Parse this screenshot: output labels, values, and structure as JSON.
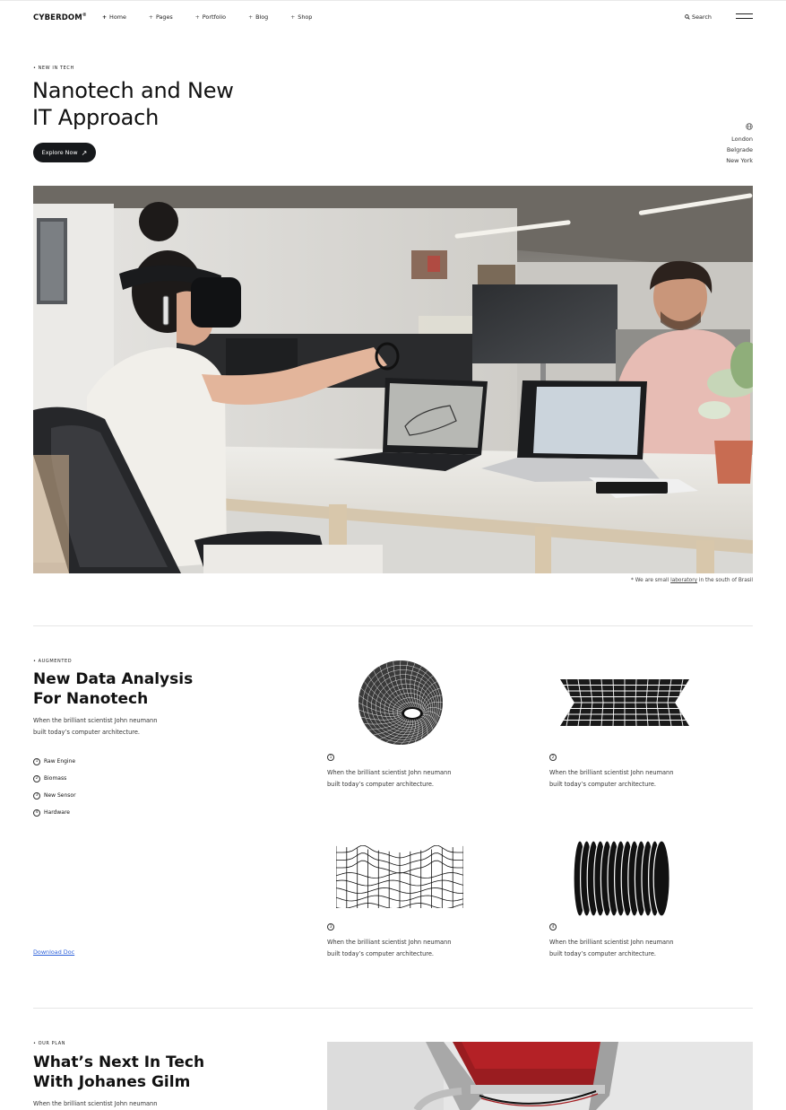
{
  "header": {
    "logo": "CYBERDOM",
    "logo_mark": "®",
    "nav": [
      {
        "label": "Home",
        "active": true
      },
      {
        "label": "Pages",
        "active": false
      },
      {
        "label": "Portfolio",
        "active": false
      },
      {
        "label": "Blog",
        "active": false
      },
      {
        "label": "Shop",
        "active": false
      }
    ],
    "search_label": "Search"
  },
  "hero": {
    "eyebrow": "New in tech",
    "title_line1": "Nanotech and New",
    "title_line2": "IT Approach",
    "cta_label": "Explore Now",
    "cities": [
      "London",
      "Belgrade",
      "New York"
    ],
    "image_alt": "Woman wearing VR headset at office desk with laptops, man working in background",
    "caption_prefix": "* We are small ",
    "caption_link": "laboratory",
    "caption_suffix": " in the south of Brasil"
  },
  "analysis": {
    "eyebrow": "Augmented",
    "title_line1": "New Data Analysis",
    "title_line2": "For Nanotech",
    "description_line1": "When the brilliant scientist John neumann",
    "description_line2": "built today’s computer architecture.",
    "features": [
      {
        "num": "1",
        "label": "Raw Engine"
      },
      {
        "num": "2",
        "label": "Biomass"
      },
      {
        "num": "3",
        "label": "New Sensor"
      },
      {
        "num": "4",
        "label": "Hardware"
      }
    ],
    "download_label": "Download Doc",
    "cards": [
      {
        "num": "1",
        "art": "wireframe-torus",
        "line1": "When the brilliant scientist John neumann",
        "line2": "built today’s computer architecture."
      },
      {
        "num": "2",
        "art": "chevron-grid",
        "line1": "When the brilliant scientist John neumann",
        "line2": "built today’s computer architecture."
      },
      {
        "num": "3",
        "art": "wave-mesh",
        "line1": "When the brilliant scientist John neumann",
        "line2": "built today’s computer architecture."
      },
      {
        "num": "4",
        "art": "disc-stack",
        "line1": "When the brilliant scientist John neumann",
        "line2": "built today’s computer architecture."
      }
    ]
  },
  "plan": {
    "eyebrow": "Our plan",
    "title_line1": "What’s Next In Tech",
    "title_line2": "With Johanes Gilm",
    "description_line1": "When the brilliant scientist John neumann",
    "image_alt": "Red robotic device with cables"
  },
  "colors": {
    "button_bg": "#16181b",
    "link": "#2b5fd9",
    "divider": "#e6e6e6"
  }
}
